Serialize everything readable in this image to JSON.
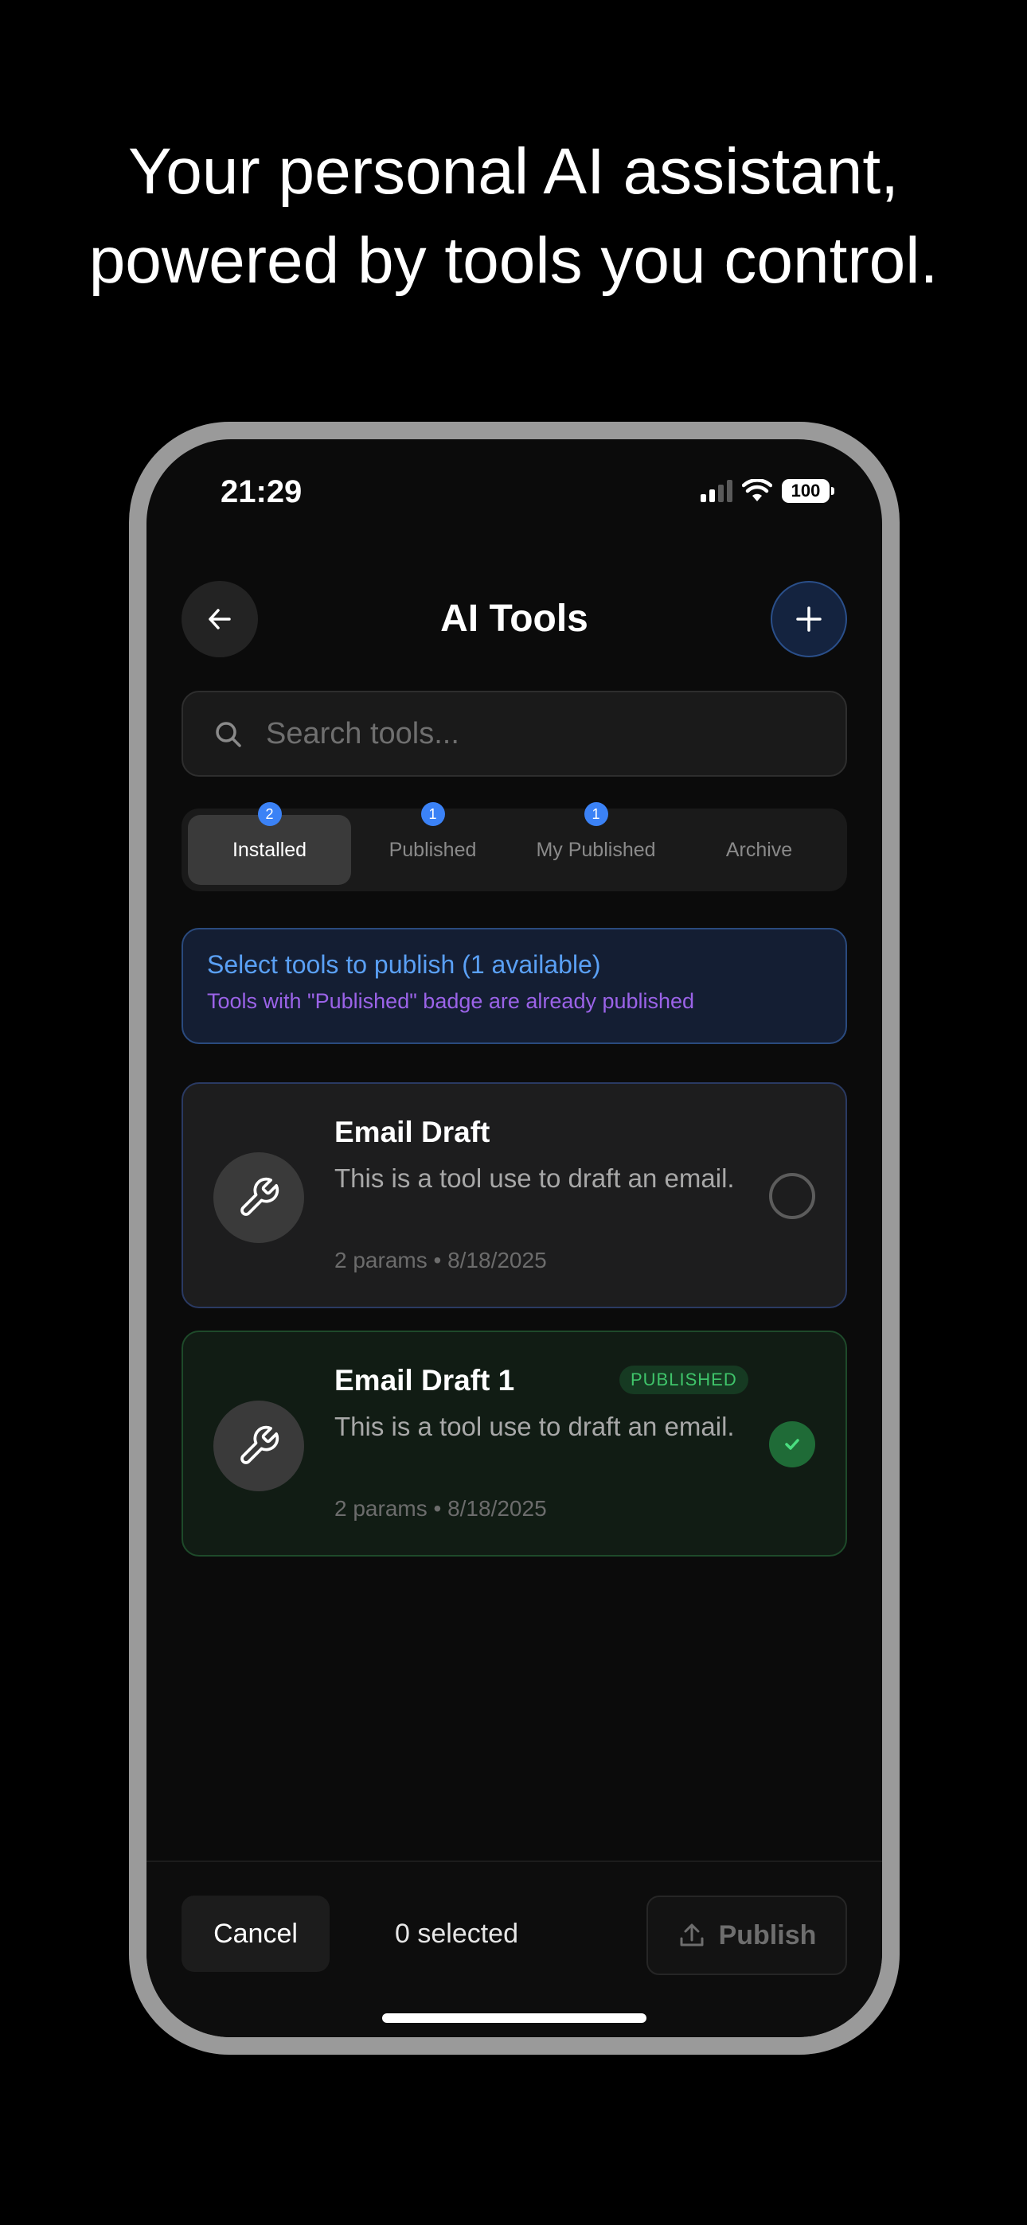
{
  "headline": {
    "line1": "Your personal AI assistant,",
    "line2": "powered by tools you control."
  },
  "status_bar": {
    "time": "21:29",
    "battery": "100"
  },
  "header": {
    "title": "AI Tools"
  },
  "search": {
    "placeholder": "Search tools...",
    "value": ""
  },
  "tabs": [
    {
      "label": "Installed",
      "badge": "2",
      "active": true
    },
    {
      "label": "Published",
      "badge": "1",
      "active": false
    },
    {
      "label": "My Published",
      "badge": "1",
      "active": false
    },
    {
      "label": "Archive",
      "badge": "",
      "active": false
    }
  ],
  "info_banner": {
    "title": "Select tools to publish (1 available)",
    "subtitle": "Tools with \"Published\" badge are already published"
  },
  "tools": [
    {
      "name": "Email Draft",
      "description": "This is a tool use to draft an email.",
      "meta": "2 params • 8/18/2025",
      "published": false
    },
    {
      "name": "Email Draft 1",
      "description": "This is a tool use to draft an email.",
      "meta": "2 params • 8/18/2025",
      "published": true,
      "badge": "PUBLISHED"
    }
  ],
  "bottom_bar": {
    "cancel_label": "Cancel",
    "selected_text": "0 selected",
    "publish_label": "Publish"
  },
  "colors": {
    "accent_blue": "#3b82f6",
    "info_title": "#5aa0f5",
    "info_subtitle": "#9b63e8",
    "published_green": "#3fc46a"
  }
}
